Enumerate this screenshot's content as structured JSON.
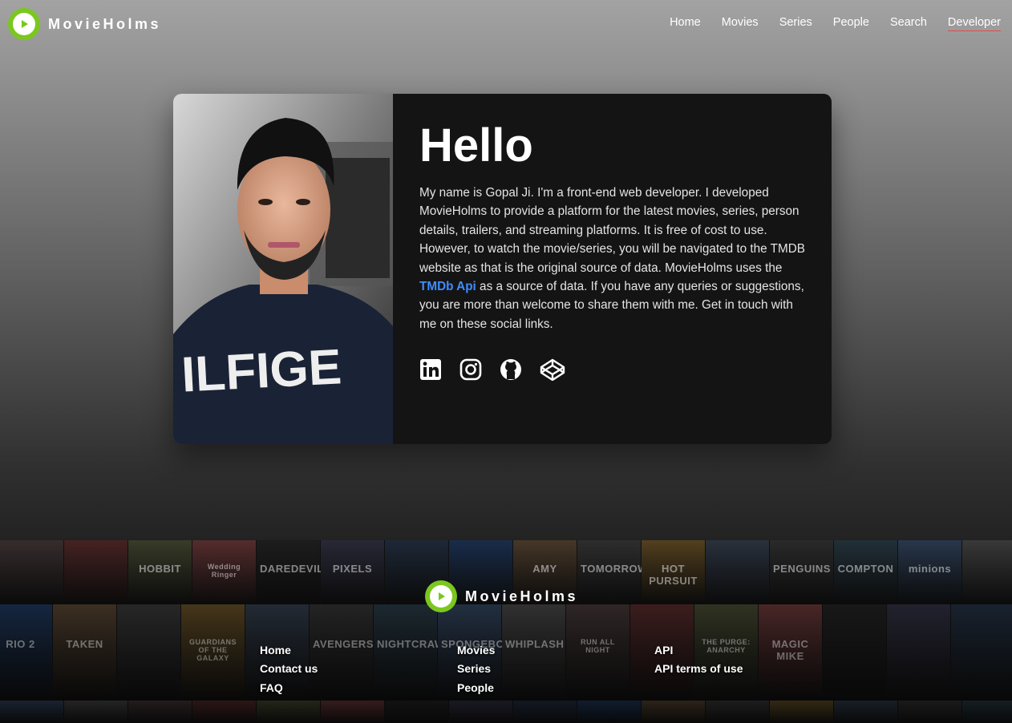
{
  "brand": {
    "name": "MovieHolms",
    "accent": "#7bc71f"
  },
  "nav": {
    "items": [
      "Home",
      "Movies",
      "Series",
      "People",
      "Search",
      "Developer"
    ],
    "active": "Developer",
    "active_underline_color": "#e34a4a"
  },
  "about": {
    "title": "Hello",
    "bio_before": "My name is Gopal Ji. I'm a front-end web developer. I developed MovieHolms to provide a platform for the latest movies, series, person details, trailers, and streaming platforms. It is free of cost to use. However, to watch the movie/series, you will be navigated to the TMDB website as that is the original source of data. MovieHolms uses the ",
    "bio_link": "TMDb Api",
    "bio_after": " as a source of data. If you have any queries or suggestions, you are more than welcome to share them with me. Get in touch with me on these social links.",
    "link_color": "#3f8cff",
    "photo_shirt_text": "ILFIGE",
    "socials": [
      "linkedin-icon",
      "instagram-icon",
      "github-icon",
      "codepen-icon"
    ]
  },
  "footer": {
    "brand": "MovieHolms",
    "col1": [
      "Home",
      "Contact us",
      "FAQ"
    ],
    "col2": [
      "Movies",
      "Series",
      "People"
    ],
    "col3": [
      "API",
      "API terms of use"
    ],
    "posters_row1": [
      "",
      "",
      "HOBBIT",
      "Wedding Ringer",
      "DAREDEVIL",
      "PIXELS",
      "",
      "",
      "AMY",
      "TOMORROWLAND",
      "HOT PURSUIT",
      "",
      "PENGUINS",
      "COMPTON",
      "minions",
      ""
    ],
    "posters_row2": [
      "RIO 2",
      "TAKEN",
      "",
      "GUARDIANS OF THE GALAXY",
      "",
      "AVENGERS",
      "NIGHTCRAWLER",
      "SPONGEBOB",
      "WHIPLASH",
      "RUN ALL NIGHT",
      "",
      "THE PURGE: ANARCHY",
      "MAGIC MIKE",
      "",
      "",
      ""
    ]
  }
}
